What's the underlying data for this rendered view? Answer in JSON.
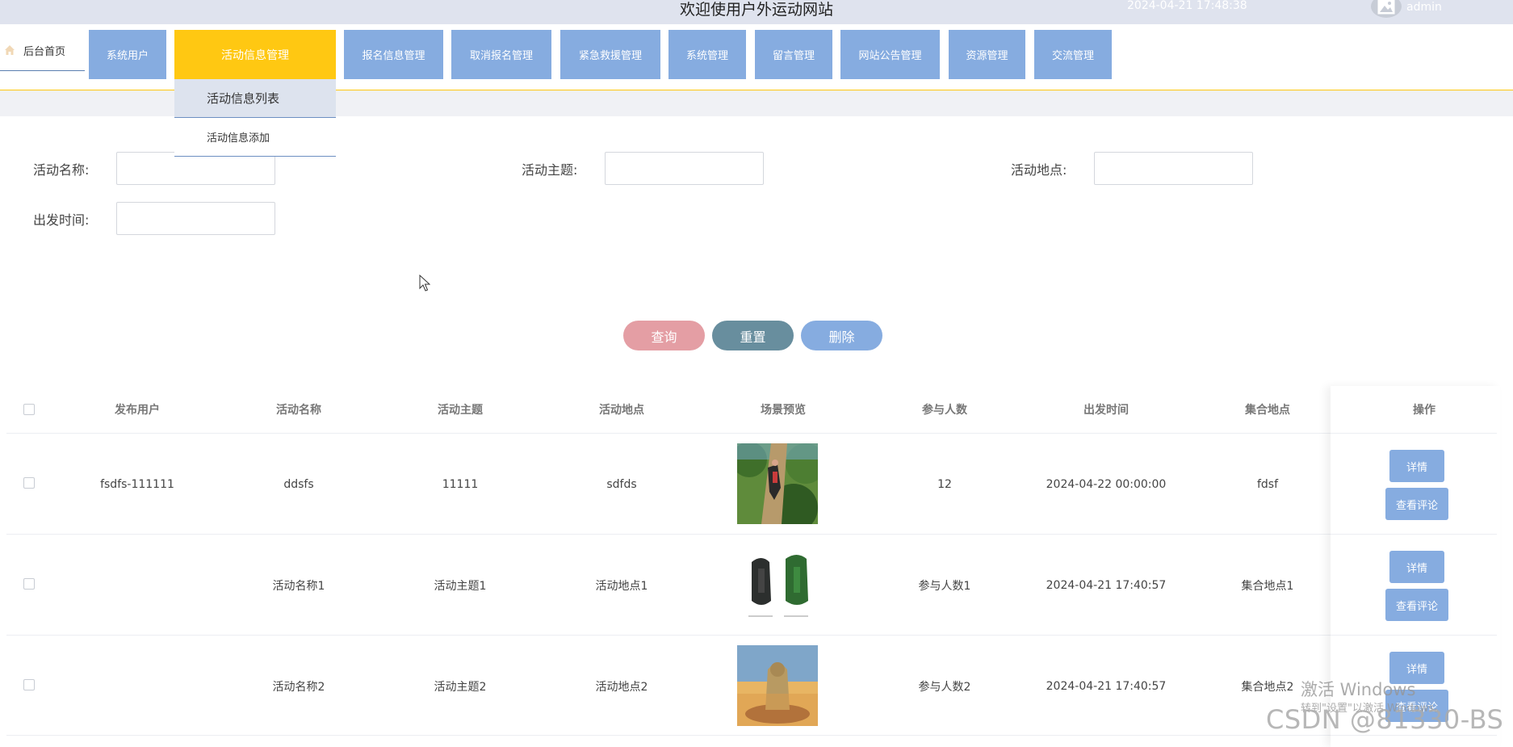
{
  "header": {
    "site_title": "欢迎使用户外运动网站",
    "datetime": "2024-04-21 17:48:38",
    "username": "admin"
  },
  "nav": {
    "home_label": "后台首页",
    "items": [
      "系统用户",
      "活动信息管理",
      "报名信息管理",
      "取消报名管理",
      "紧急救援管理",
      "系统管理",
      "留言管理",
      "网站公告管理",
      "资源管理",
      "交流管理"
    ],
    "active": "活动信息管理",
    "dropdown": [
      "活动信息列表",
      "活动信息添加"
    ]
  },
  "search": {
    "fields": [
      {
        "label": "活动名称:",
        "value": ""
      },
      {
        "label": "活动主题:",
        "value": ""
      },
      {
        "label": "活动地点:",
        "value": ""
      },
      {
        "label": "出发时间:",
        "value": ""
      }
    ],
    "buttons": {
      "query": "查询",
      "reset": "重置",
      "delete": "删除"
    }
  },
  "table": {
    "headers": [
      "发布用户",
      "活动名称",
      "活动主题",
      "活动地点",
      "场景预览",
      "参与人数",
      "出发时间",
      "集合地点",
      "操作"
    ],
    "rows": [
      {
        "user": "fsdfs-111111",
        "name": "ddsfs",
        "theme": "11111",
        "location": "sdfds",
        "participants": "12",
        "departure": "2024-04-22 00:00:00",
        "meeting_point": "fdsf"
      },
      {
        "user": "",
        "name": "活动名称1",
        "theme": "活动主题1",
        "location": "活动地点1",
        "participants": "参与人数1",
        "departure": "2024-04-21 17:40:57",
        "meeting_point": "集合地点1"
      },
      {
        "user": "",
        "name": "活动名称2",
        "theme": "活动主题2",
        "location": "活动地点2",
        "participants": "参与人数2",
        "departure": "2024-04-21 17:40:57",
        "meeting_point": "集合地点2"
      }
    ],
    "actions": {
      "detail": "详情",
      "comments": "查看评论"
    }
  },
  "overlay": {
    "activate_windows": "激活 Windows",
    "activate_hint": "转到\"设置\"以激活 Windows。",
    "csdn": "CSDN @81330-BS"
  },
  "colors": {
    "nav_button": "#86ace0",
    "nav_active": "#ffc812",
    "query_button": "#e49ea4",
    "reset_button": "#688e9e",
    "delete_button": "#86ace0"
  }
}
